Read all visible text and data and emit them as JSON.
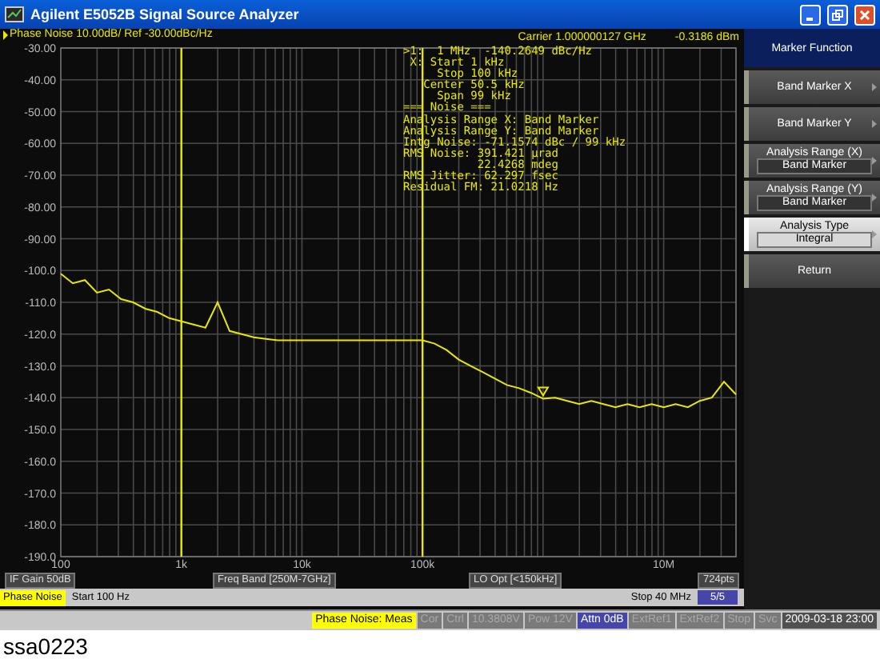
{
  "window": {
    "title": "Agilent E5052B Signal Source Analyzer"
  },
  "trace_header": "Phase Noise 10.00dB/ Ref -30.00dBc/Hz",
  "carrier": {
    "frequency": "Carrier 1.000000127 GHz",
    "power": "-0.3186 dBm"
  },
  "marker_readout": [
    ">1:  1 MHz  -140.2649 dBc/Hz",
    " X: Start 1 kHz",
    "     Stop 100 kHz",
    "   Center 50.5 kHz",
    "     Span 99 kHz",
    "=== Noise ===",
    "Analysis Range X: Band Marker",
    "Analysis Range Y: Band Marker",
    "Intg Noise: -71.1574 dBc / 99 kHz",
    "RMS Noise: 391.421 µrad",
    "           22.4268 mdeg",
    "RMS Jitter: 62.297 fsec",
    "Residual FM: 21.0218 Hz"
  ],
  "chart_data": {
    "type": "line",
    "categories": [
      "100",
      null,
      null,
      null,
      null,
      null,
      null,
      null,
      null,
      null,
      "1k",
      null,
      null,
      null,
      null,
      null,
      null,
      null,
      null,
      null,
      "10k",
      null,
      null,
      null,
      null,
      null,
      null,
      null,
      null,
      null,
      "100k",
      null,
      null,
      null,
      null,
      null,
      null,
      null,
      null,
      null,
      null,
      null,
      null,
      null,
      null,
      null,
      null,
      null,
      null,
      null,
      "10M",
      null,
      null,
      null,
      null,
      null,
      null
    ],
    "series": [
      {
        "color": "#e8e800",
        "values": [
          -101,
          -104,
          -103,
          -107,
          -106,
          -109,
          -110,
          -112,
          -113,
          -115,
          -116,
          -117,
          -118,
          -110,
          -119,
          -120,
          -121,
          -121.5,
          -122,
          -122,
          -122,
          -122,
          -122,
          -122,
          -122,
          -122,
          -122,
          -122,
          -122,
          -122,
          -122,
          -123,
          -125,
          -128,
          -130,
          -132,
          -134,
          -136,
          -137,
          -138.5,
          -140.3,
          -140,
          -141,
          -142,
          -141,
          -142,
          -143,
          -142,
          -143,
          -142,
          -143,
          -142,
          -143,
          -141,
          -140,
          -135,
          -139
        ]
      }
    ],
    "ylim": [
      -190,
      -30
    ],
    "yticks": [
      {
        "value": -30,
        "label": "-30.00"
      },
      {
        "value": -40,
        "label": "-40.00"
      },
      {
        "value": -50,
        "label": "-50.00"
      },
      {
        "value": -60,
        "label": "-60.00"
      },
      {
        "value": -70,
        "label": "-70.00"
      },
      {
        "value": -80,
        "label": "-80.00"
      },
      {
        "value": -90,
        "label": "-90.00"
      },
      {
        "value": -100,
        "label": "-100.0"
      },
      {
        "value": -110,
        "label": "-110.0"
      },
      {
        "value": -120,
        "label": "-120.0"
      },
      {
        "value": -130,
        "label": "-130.0"
      },
      {
        "value": -140,
        "label": "-140.0"
      },
      {
        "value": -150,
        "label": "-150.0"
      },
      {
        "value": -160,
        "label": "-160.0"
      },
      {
        "value": -170,
        "label": "-170.0"
      },
      {
        "value": -180,
        "label": "-180.0"
      },
      {
        "value": -190,
        "label": "-190.0"
      }
    ],
    "grid": true
  },
  "info_bar": [
    "IF Gain 50dB",
    "Freq Band [250M-7GHz]",
    "LO Opt [<150kHz]",
    "724pts"
  ],
  "status_row": {
    "measurement": "Phase Noise",
    "start": "Start 100 Hz",
    "stop": "Stop 40 MHz",
    "page": "5/5"
  },
  "softkeys": {
    "title": "Marker Function",
    "items": [
      {
        "kind": "button",
        "label": "Band Marker X",
        "selected": false
      },
      {
        "kind": "button",
        "label": "Band Marker Y",
        "selected": false
      },
      {
        "kind": "selector",
        "label": "Analysis Range (X)",
        "value": "Band Marker",
        "selected": false
      },
      {
        "kind": "selector",
        "label": "Analysis Range (Y)",
        "value": "Band Marker",
        "selected": false
      },
      {
        "kind": "selector",
        "label": "Analysis Type",
        "value": "Integral",
        "selected": true
      },
      {
        "kind": "plain",
        "label": "Return",
        "selected": false
      }
    ]
  },
  "status_bar": [
    {
      "kind": "highlight",
      "text": "Phase Noise: Meas"
    },
    {
      "kind": "dim",
      "text": "Cor"
    },
    {
      "kind": "dim",
      "text": "Ctrl"
    },
    {
      "kind": "dim",
      "text": "10.3808V"
    },
    {
      "kind": "dim",
      "text": "Pow  12V"
    },
    {
      "kind": "on",
      "text": "Attn 0dB"
    },
    {
      "kind": "dim",
      "text": "ExtRef1"
    },
    {
      "kind": "dim",
      "text": "ExtRef2"
    },
    {
      "kind": "dim",
      "text": "Stop"
    },
    {
      "kind": "dim",
      "text": "Svc"
    },
    {
      "kind": "plain",
      "text": "2009-03-18 23:00"
    }
  ],
  "caption": "ssa0223"
}
